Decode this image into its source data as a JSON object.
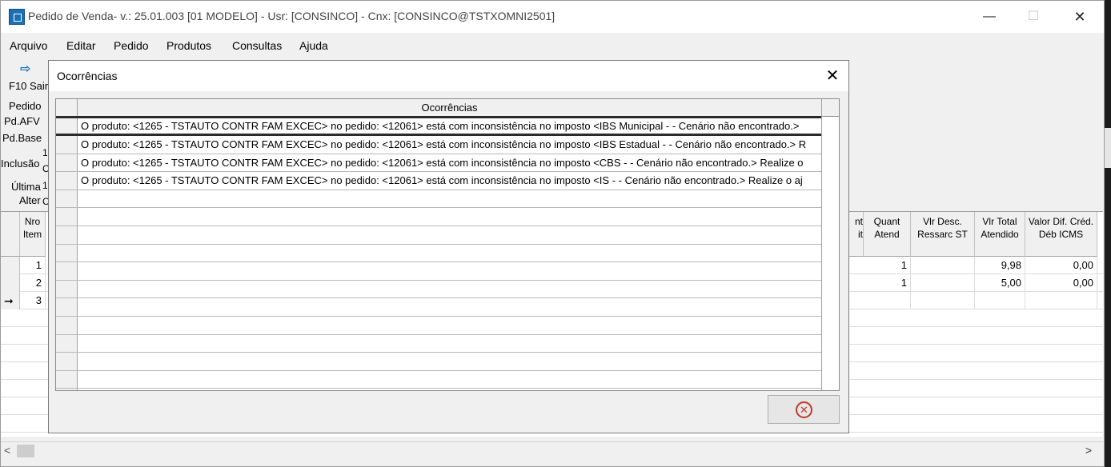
{
  "window": {
    "title": "Pedido de Venda- v.: 25.01.003  [01 MODELO] - Usr: [CONSINCO] - Cnx: [CONSINCO@TSTXOMNI2501]",
    "minimize": "—",
    "maximize": "☐",
    "close": "✕"
  },
  "menu": {
    "items": [
      "Arquivo",
      "Editar",
      "Pedido",
      "Produtos",
      "Consultas",
      "Ajuda"
    ]
  },
  "toolbar": {
    "exit_label": "F10 Sair"
  },
  "form_labels": {
    "pedido": "Pedido",
    "pd_afv": "Pd.AFV",
    "pd_base": "Pd.Base",
    "inclusao": "Inclusão",
    "ultima": "Última",
    "alter": "Alter",
    "extra_1": "1",
    "extra_c": "C"
  },
  "background_grid": {
    "header_nro": "Nro Item",
    "header_quant": "Quant Atend",
    "header_vlr_desc": "Vlr Desc. Ressarc ST",
    "header_vlr_total": "Vlr Total Atendido",
    "header_valor_dif": "Valor Dif. Créd. Déb ICMS",
    "header_partial_1": "nt",
    "header_partial_2": "it",
    "rows": [
      {
        "nro": "1",
        "quant": "1",
        "vlr_total": "9,98",
        "valor_dif": "0,00"
      },
      {
        "nro": "2",
        "quant": "1",
        "vlr_total": "5,00",
        "valor_dif": "0,00"
      },
      {
        "nro": "3",
        "quant": "",
        "vlr_total": "",
        "valor_dif": ""
      }
    ],
    "current_row_marker": "➞"
  },
  "dialog": {
    "title": "Ocorrências",
    "close": "✕",
    "column_header": "Ocorrências",
    "rows": [
      "O produto: <1265 - TSTAUTO CONTR FAM EXCEC> no pedido: <12061> está com inconsistência no imposto <IBS Municipal - - Cenário não encontrado.>",
      "O produto: <1265 - TSTAUTO CONTR FAM EXCEC> no pedido: <12061> está com inconsistência no imposto <IBS Estadual - - Cenário não encontrado.> R",
      "O produto: <1265 - TSTAUTO CONTR FAM EXCEC> no pedido: <12061> está com inconsistência no imposto <CBS - - Cenário não encontrado.> Realize o",
      "O produto: <1265 - TSTAUTO CONTR FAM EXCEC> no pedido: <12061> está com inconsistência no imposto <IS - - Cenário não encontrado.> Realize o aj"
    ],
    "close_button_icon": "close-circle-icon"
  },
  "scrollbar": {
    "left_arrow": "<",
    "right_arrow": ">"
  }
}
